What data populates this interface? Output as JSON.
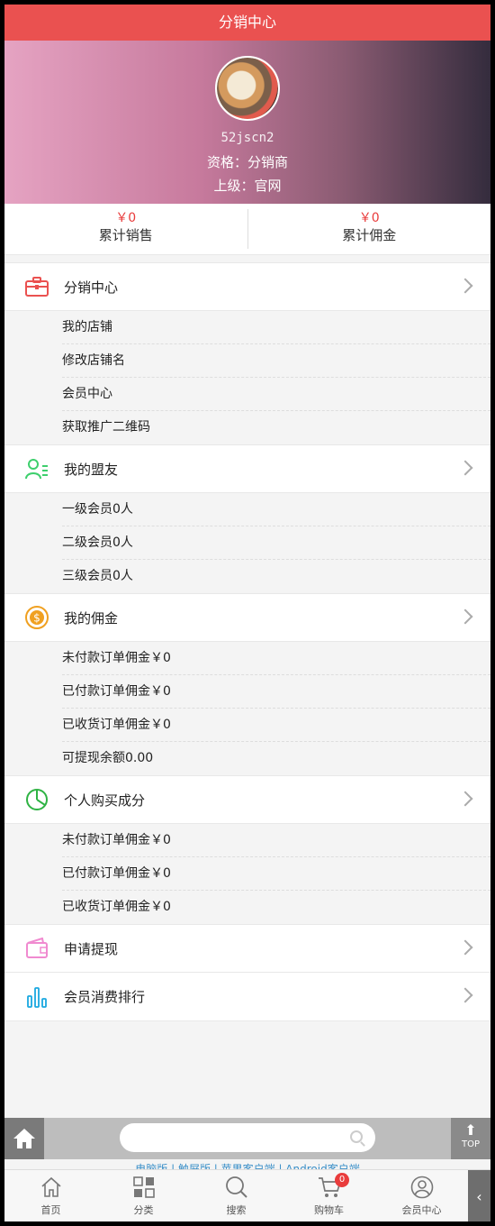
{
  "header": {
    "title": "分销中心"
  },
  "profile": {
    "username": "52jscn2",
    "qualification": "资格：分销商",
    "superior": "上级：官网"
  },
  "stats": [
    {
      "amount": "￥0",
      "label": "累计销售"
    },
    {
      "amount": "￥0",
      "label": "累计佣金"
    }
  ],
  "sections": [
    {
      "title": "分销中心",
      "icon": "briefcase-icon",
      "color": "#ea5150",
      "items": [
        "我的店铺",
        "修改店铺名",
        "会员中心",
        "获取推广二维码"
      ]
    },
    {
      "title": "我的盟友",
      "icon": "people-list-icon",
      "color": "#3ecf6d",
      "items": [
        "一级会员0人",
        "二级会员0人",
        "三级会员0人"
      ]
    },
    {
      "title": "我的佣金",
      "icon": "dollar-coin-icon",
      "color": "#f0a020",
      "items": [
        "未付款订单佣金￥0",
        "已付款订单佣金￥0",
        "已收货订单佣金￥0",
        "可提现余额0.00"
      ]
    },
    {
      "title": "个人购买成分",
      "icon": "pie-chart-icon",
      "color": "#2fb344",
      "items": [
        "未付款订单佣金￥0",
        "已付款订单佣金￥0",
        "已收货订单佣金￥0"
      ]
    },
    {
      "title": "申请提现",
      "icon": "wallet-icon",
      "color": "#f08ad0",
      "items": []
    },
    {
      "title": "会员消费排行",
      "icon": "bar-chart-icon",
      "color": "#1aa8e0",
      "items": []
    }
  ],
  "search": {
    "placeholder": ""
  },
  "top_button": {
    "label": "TOP"
  },
  "footer_links": "电脑版 | 触屏版 | 苹果客户端 | Android客户端",
  "tabbar": [
    {
      "label": "首页",
      "icon": "home-icon"
    },
    {
      "label": "分类",
      "icon": "grid-icon"
    },
    {
      "label": "搜索",
      "icon": "search-icon"
    },
    {
      "label": "购物车",
      "icon": "cart-icon",
      "badge": "0"
    },
    {
      "label": "会员中心",
      "icon": "user-circle-icon"
    }
  ]
}
